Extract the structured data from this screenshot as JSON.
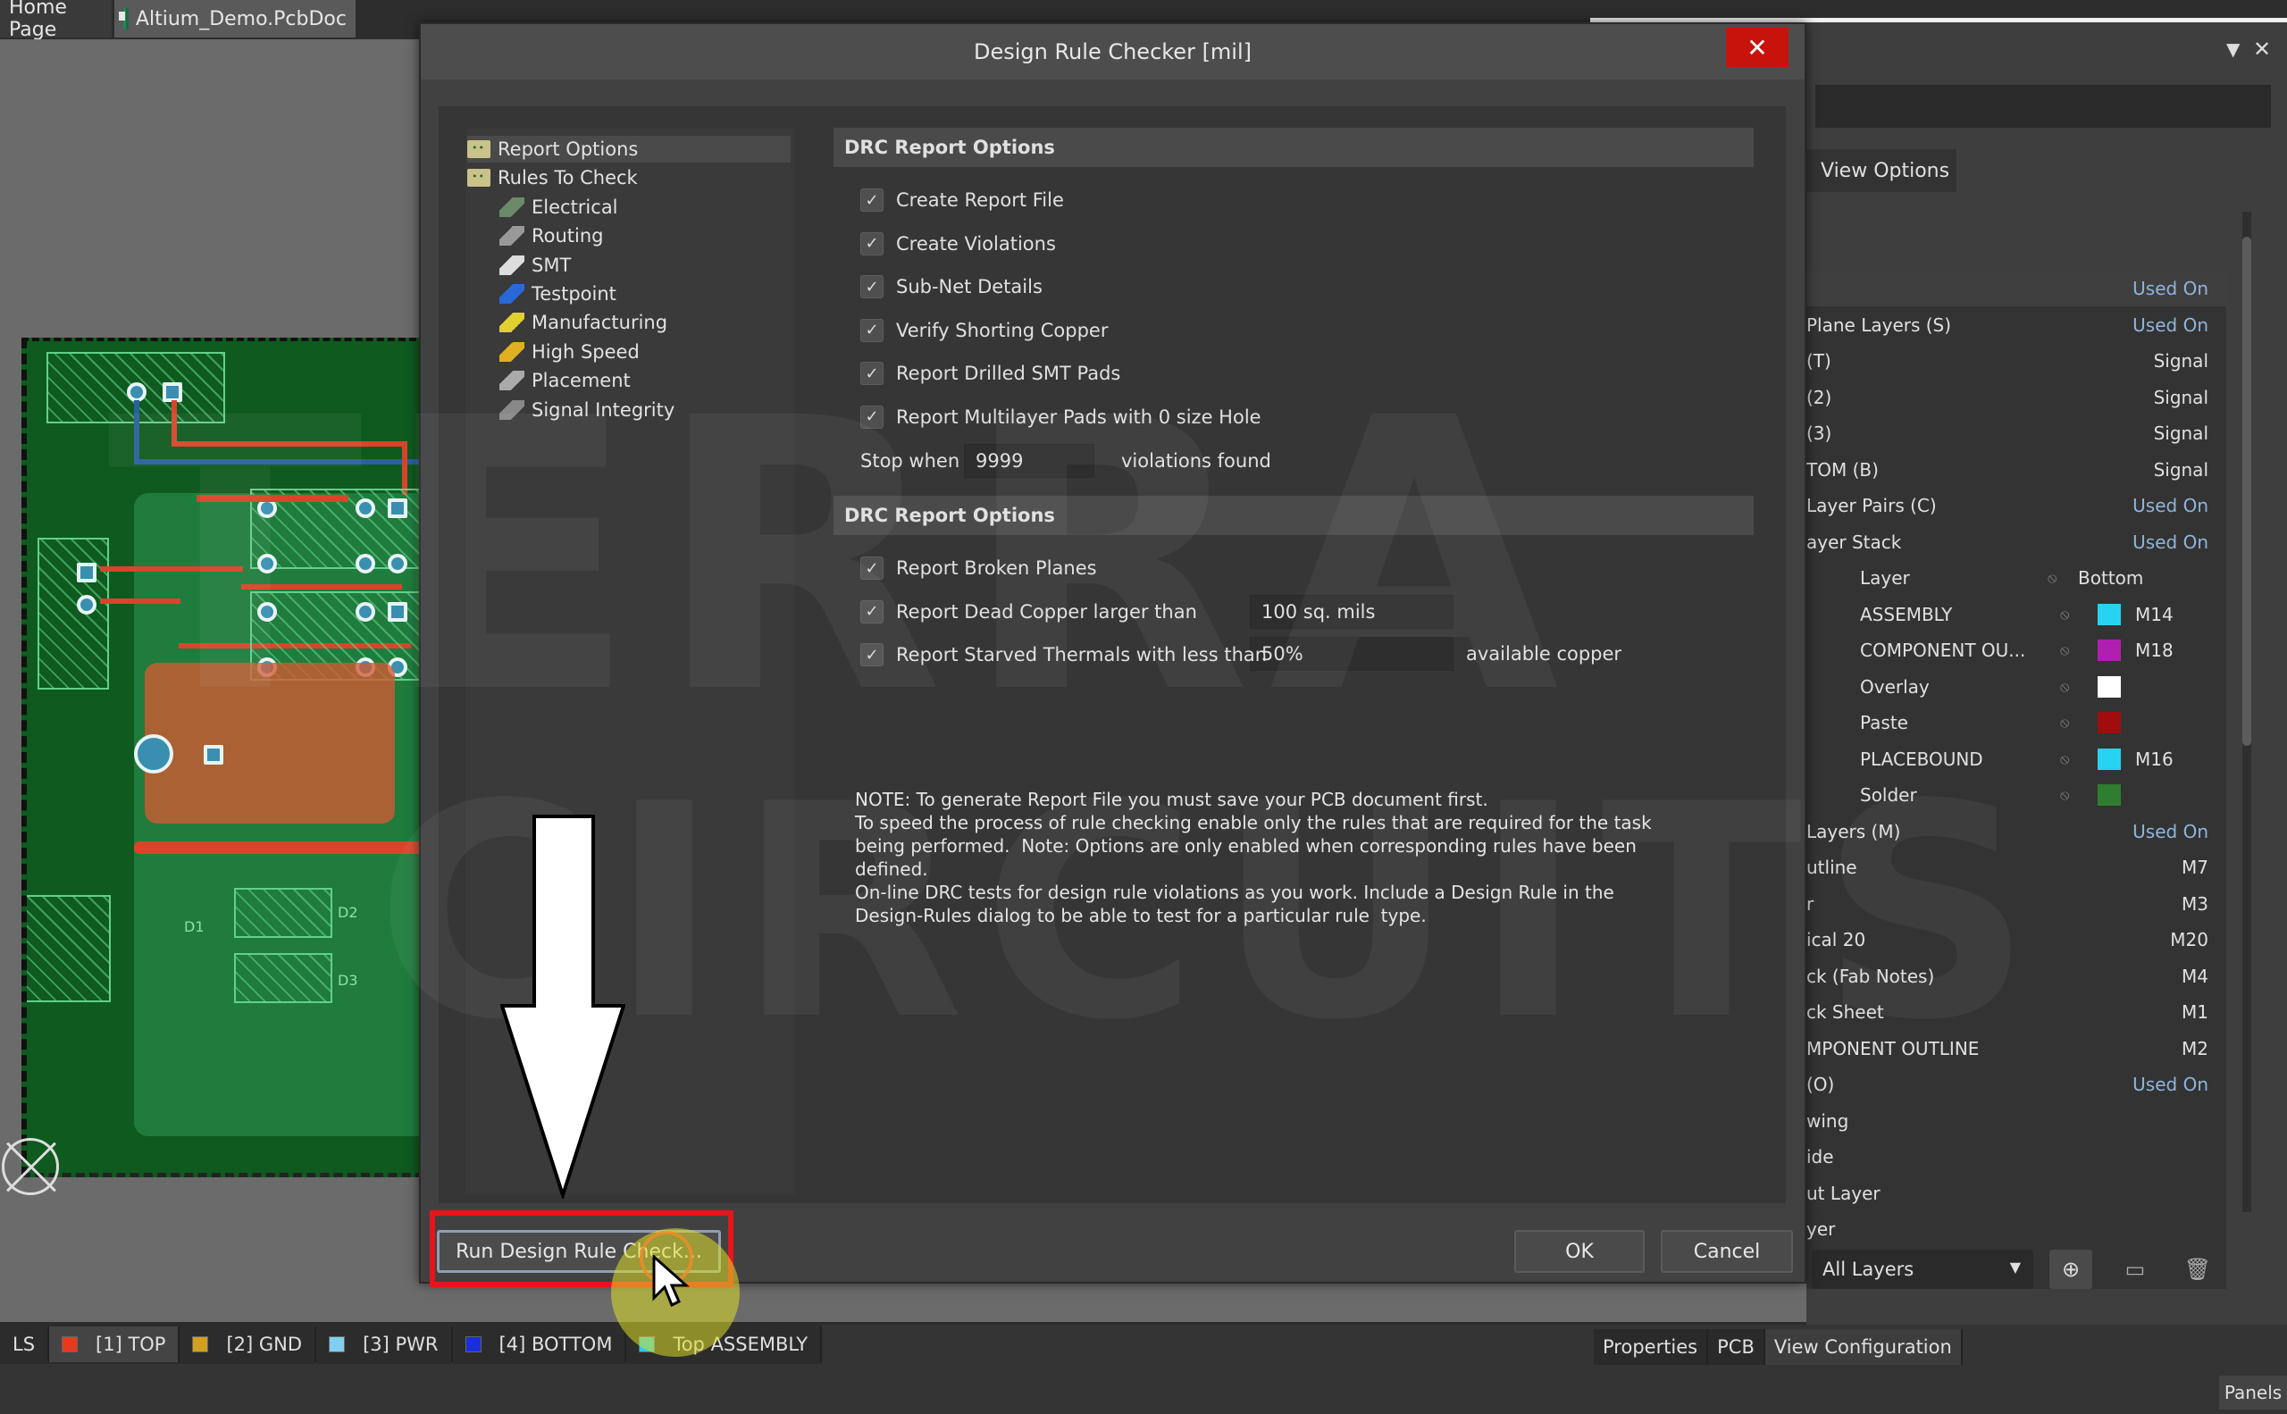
{
  "doc_tabs": [
    {
      "label": "Home Page",
      "active": false
    },
    {
      "label": "Altium_Demo.PcbDoc",
      "active": true,
      "icon": "pcb-document-icon"
    }
  ],
  "dialog": {
    "title": "Design Rule Checker [mil]",
    "close_icon": "close-icon",
    "tree": [
      {
        "label": "Report Options",
        "icon": "folder-icon",
        "level": 0,
        "selected": true
      },
      {
        "label": "Rules To Check",
        "icon": "folder-icon",
        "level": 0,
        "selected": false
      },
      {
        "label": "Electrical",
        "icon": "electrical-icon",
        "level": 1
      },
      {
        "label": "Routing",
        "icon": "routing-icon",
        "level": 1
      },
      {
        "label": "SMT",
        "icon": "smt-icon",
        "level": 1
      },
      {
        "label": "Testpoint",
        "icon": "testpoint-icon",
        "level": 1
      },
      {
        "label": "Manufacturing",
        "icon": "manufacturing-icon",
        "level": 1
      },
      {
        "label": "High Speed",
        "icon": "high-speed-icon",
        "level": 1
      },
      {
        "label": "Placement",
        "icon": "placement-icon",
        "level": 1
      },
      {
        "label": "Signal Integrity",
        "icon": "signal-integrity-icon",
        "level": 1
      }
    ],
    "section1": {
      "header": "DRC Report Options",
      "options": [
        {
          "label": "Create Report File",
          "checked": true
        },
        {
          "label": "Create Violations",
          "checked": true
        },
        {
          "label": "Sub-Net Details",
          "checked": true
        },
        {
          "label": "Verify Shorting Copper",
          "checked": true
        },
        {
          "label": "Report Drilled SMT Pads",
          "checked": true
        },
        {
          "label": "Report Multilayer Pads with 0 size Hole",
          "checked": true
        }
      ],
      "stop_when_label": "Stop when",
      "stop_when_value": "9999",
      "violations_found_label": "violations found"
    },
    "section2": {
      "header": "DRC Report Options",
      "options": [
        {
          "label": "Report Broken Planes",
          "checked": true
        },
        {
          "label": "Report Dead Copper larger than",
          "checked": true,
          "value": "100 sq. mils"
        },
        {
          "label": "Report Starved Thermals with less than",
          "checked": true,
          "value": "50%",
          "suffix": "available copper"
        }
      ]
    },
    "note_lines": [
      "NOTE: To generate Report File you must save your PCB document first.",
      "To speed the process of rule checking enable only the rules that are required for the task",
      "being performed.  Note: Options are only enabled when corresponding rules have been",
      "defined.",
      "On-line DRC tests for design rule violations as you work. Include a Design Rule in the",
      "Design-Rules dialog to be able to test for a particular rule  type."
    ],
    "buttons": {
      "run": "Run Design Rule Check...",
      "ok": "OK",
      "cancel": "Cancel"
    }
  },
  "annotation": {
    "arrow": "down-arrow",
    "highlight_color": "#e8141c"
  },
  "watermark": {
    "line1": "TERRA",
    "line2": "CIRCUITS"
  },
  "right_panel": {
    "tab": "View Options",
    "rows": [
      {
        "name": "",
        "value": "Used On",
        "kind": "used"
      },
      {
        "name": "Plane Layers (S)",
        "value": "Used On",
        "kind": "used"
      },
      {
        "name": "(T)",
        "value": "Signal"
      },
      {
        "name": "(2)",
        "value": "Signal"
      },
      {
        "name": "(3)",
        "value": "Signal"
      },
      {
        "name": "TOM (B)",
        "value": "Signal"
      },
      {
        "name": "Layer Pairs (C)",
        "value": "Used On",
        "kind": "used"
      },
      {
        "name": "ayer Stack",
        "value": "Used On",
        "kind": "used"
      },
      {
        "name": "Layer",
        "sub": true,
        "header": true,
        "value": "Bottom"
      },
      {
        "name": "ASSEMBLY",
        "sub": true,
        "color": "#27d3f0",
        "mlayer": "M14"
      },
      {
        "name": "COMPONENT OU...",
        "sub": true,
        "color": "#b020b0",
        "mlayer": "M18"
      },
      {
        "name": "Overlay",
        "sub": true,
        "color": "#ffffff",
        "mlayer": ""
      },
      {
        "name": "Paste",
        "sub": true,
        "color": "#a00d0d",
        "mlayer": ""
      },
      {
        "name": "PLACEBOUND",
        "sub": true,
        "color": "#27d3f0",
        "mlayer": "M16"
      },
      {
        "name": "Solder",
        "sub": true,
        "color": "#2f7d2f",
        "mlayer": ""
      },
      {
        "name": "Layers (M)",
        "value": "Used On",
        "kind": "used"
      },
      {
        "name": "utline",
        "value": "M7"
      },
      {
        "name": "r",
        "value": "M3"
      },
      {
        "name": "ical 20",
        "value": "M20"
      },
      {
        "name": "ck (Fab Notes)",
        "value": "M4"
      },
      {
        "name": "ck Sheet",
        "value": "M1"
      },
      {
        "name": "MPONENT OUTLINE",
        "value": "M2"
      },
      {
        "name": "(O)",
        "value": "Used On",
        "kind": "used"
      },
      {
        "name": "wing",
        "value": ""
      },
      {
        "name": "ide",
        "value": ""
      },
      {
        "name": "ut Layer",
        "value": ""
      },
      {
        "name": "yer",
        "value": ""
      }
    ],
    "layer_set": "All Layers"
  },
  "layer_tabs": [
    {
      "label": "LS",
      "color": ""
    },
    {
      "label": "[1] TOP",
      "color": "#e63a1e",
      "active": true
    },
    {
      "label": "[2] GND",
      "color": "#d4a020"
    },
    {
      "label": "[3] PWR",
      "color": "#7fd0f0"
    },
    {
      "label": "[4] BOTTOM",
      "color": "#1a2ee0"
    },
    {
      "label": "Top ASSEMBLY",
      "color": "#30c8f0"
    }
  ],
  "panel_tabs": [
    {
      "label": "Properties",
      "active": false
    },
    {
      "label": "PCB",
      "active": false
    },
    {
      "label": "View Configuration",
      "active": true
    }
  ],
  "panels_button": "Panels",
  "pcb_labels": [
    "D1",
    "D2",
    "D3"
  ]
}
